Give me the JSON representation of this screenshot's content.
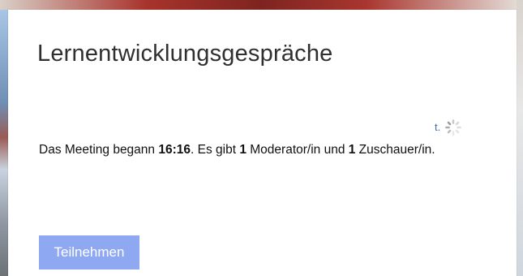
{
  "card": {
    "title": "Lernentwicklungsgespräche",
    "loading_fragment": "t.",
    "status": {
      "prefix": "Das Meeting begann ",
      "start_time": "16:16",
      "mid1": ". Es gibt ",
      "moderators": "1",
      "mid2": " Moderator/in und ",
      "viewers": "1",
      "suffix": " Zuschauer/in."
    },
    "join_button": "Teilnehmen"
  },
  "colors": {
    "join_button_bg": "#8fa8f2",
    "link_text": "#3b6ea5"
  },
  "icons": {
    "loading": "loading-spinner-icon"
  }
}
